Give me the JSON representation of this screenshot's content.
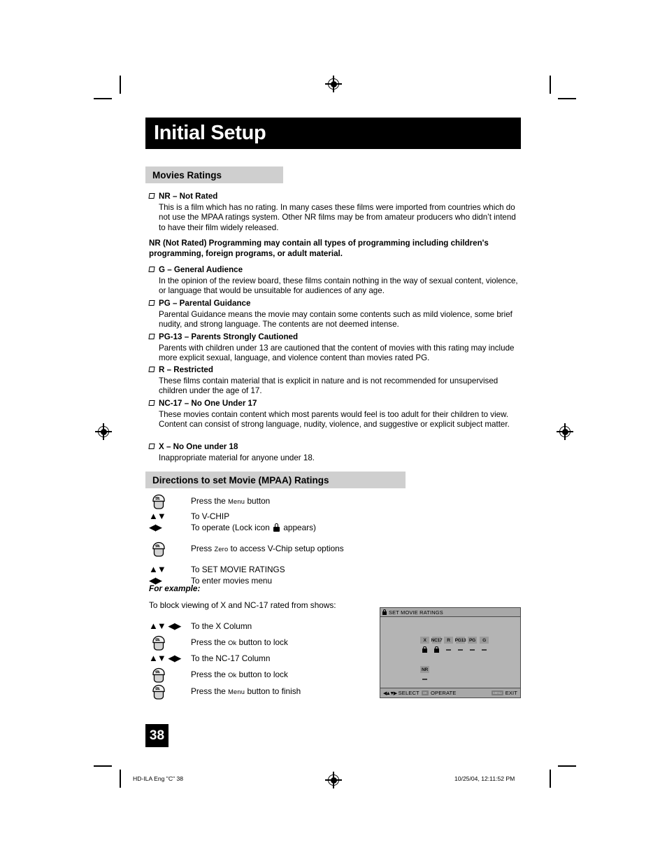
{
  "document": {
    "title": "Initial Setup",
    "page_number": "38",
    "footer_left": "HD-ILA Eng \"C\"   38",
    "footer_right": "10/25/04, 12:11:52 PM"
  },
  "sections": {
    "movies_ratings_header": "Movies Ratings",
    "directions_header": "Directions to set Movie (MPAA) Ratings"
  },
  "ratings": [
    {
      "title": "NR – Not Rated",
      "body": "This is a film which has no rating. In many cases these films were imported from countries which do not use the MPAA ratings system. Other NR films may be from amateur producers who didn’t intend to have their film widely released."
    },
    {
      "title": "G – General Audience",
      "body": "In the opinion of the review board, these films contain nothing in the way of sexual content, violence, or language that would be unsuitable for audiences of any age."
    },
    {
      "title": "PG – Parental Guidance",
      "body": "Parental Guidance means the movie may contain some contents such as mild violence, some brief nudity, and strong language. The contents are not deemed intense."
    },
    {
      "title": "PG-13 – Parents Strongly Cautioned",
      "body": "Parents with children under 13 are cautioned that the content of movies with this rating may include more explicit sexual, language, and violence content than movies rated PG."
    },
    {
      "title": "R – Restricted",
      "body": "These films contain material that is explicit in nature and is not recommended for unsupervised children under the age of 17."
    },
    {
      "title": "NC-17 – No One Under 17",
      "body": "These movies contain content which most parents would feel is too adult for their children to view. Content can consist of strong language, nudity, violence, and suggestive or explicit subject matter."
    },
    {
      "title": "X – No One under 18",
      "body": "Inappropriate material for anyone under 18."
    }
  ],
  "nr_note": "NR (Not Rated) Programming may contain all types of programming including children's programming, foreign programs, or adult material.",
  "directions": [
    {
      "icon": "hand-press",
      "text_pre": "Press the ",
      "small_caps": "Menu",
      "text_post": " button"
    },
    {
      "icon": "updown",
      "text_pre": "To V-CHIP",
      "small_caps": "",
      "text_post": ""
    },
    {
      "icon": "leftright",
      "text_pre": "To operate (Lock icon ",
      "small_caps": "",
      "text_post": " appears)",
      "has_lock": true
    },
    {
      "icon": "hand-press",
      "text_pre": "Press ",
      "small_caps": "Zero",
      "text_post": " to access V-Chip setup options"
    },
    {
      "icon": "updown",
      "text_pre": "To SET MOVIE RATINGS",
      "small_caps": "",
      "text_post": ""
    },
    {
      "icon": "leftright",
      "text_pre": "To enter movies menu",
      "small_caps": "",
      "text_post": ""
    }
  ],
  "example": {
    "label": "For example:",
    "intro": "To block viewing of X and NC-17 rated from shows:",
    "steps": [
      {
        "icon": "arrows4",
        "text_pre": "To the X Column",
        "small_caps": "",
        "text_post": ""
      },
      {
        "icon": "hand-press",
        "text_pre": "Press the ",
        "small_caps": "Ok",
        "text_post": " button to lock"
      },
      {
        "icon": "arrows4",
        "text_pre": "To the NC-17 Column",
        "small_caps": "",
        "text_post": ""
      },
      {
        "icon": "hand-press",
        "text_pre": "Press the ",
        "small_caps": "Ok",
        "text_post": " button to lock"
      },
      {
        "icon": "hand-press",
        "text_pre": "Press the ",
        "small_caps": "Menu",
        "text_post": " button to finish"
      }
    ]
  },
  "osd": {
    "title": "SET MOVIE RATINGS",
    "title_icon": "lock-icon",
    "rating_columns": [
      "X",
      "NC17",
      "R",
      "PG13",
      "PG",
      "G"
    ],
    "rating_states": [
      "locked",
      "locked",
      "unlocked",
      "unlocked",
      "unlocked",
      "unlocked"
    ],
    "nr_column": [
      "NR"
    ],
    "nr_states": [
      "unlocked"
    ],
    "footer_select": "SELECT",
    "footer_operate": "OPERATE",
    "footer_exit": "EXIT",
    "footer_operate_btn": "OK",
    "footer_exit_btn": "MENU"
  },
  "colors": {
    "banner_bg": "#000000",
    "section_header_bg": "#cfcfcf",
    "osd_bg": "#b4b4b4",
    "osd_cell": "#9a9a9a"
  }
}
